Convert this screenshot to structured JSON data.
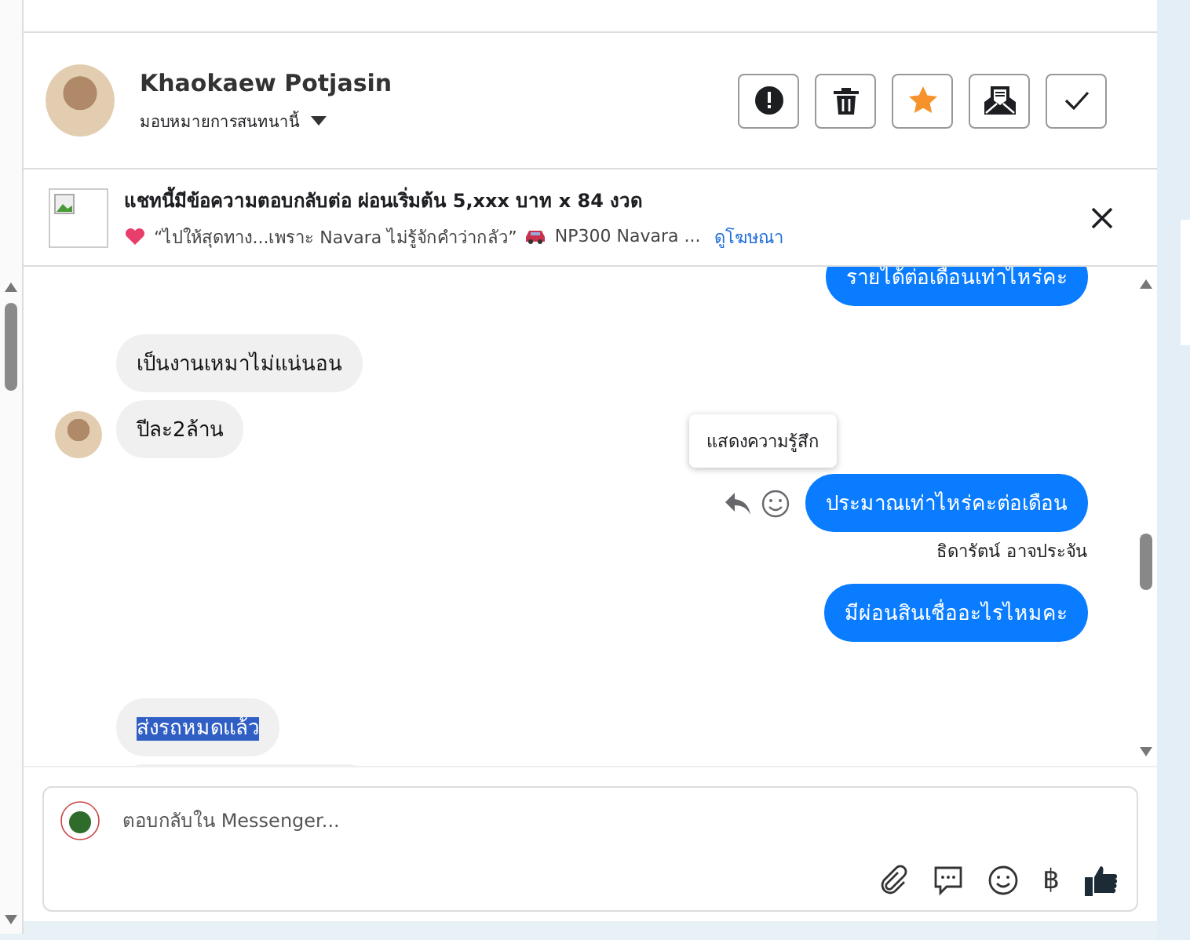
{
  "contact": {
    "name": "Khaokaew Potjasin",
    "assign_label": "มอบหมายการสนทนานี้"
  },
  "header_buttons": [
    {
      "kind": "alert"
    },
    {
      "kind": "trash"
    },
    {
      "kind": "star"
    },
    {
      "kind": "mail"
    },
    {
      "kind": "check"
    }
  ],
  "ad": {
    "title": "แชทนี้มีข้อความตอบกลับต่อ ผ่อนเริ่มต้น 5,xxx บาท x 84 งวด",
    "subtitle": "“ไปให้สุดทาง...เพราะ Navara ไม่รู้จักคำว่ากลัว”",
    "subtitle_2": "NP300 Navara ...",
    "link": "ดูโฆษณา"
  },
  "messages": [
    {
      "kind": "outgoing",
      "text": "รายได้ต่อเดือนเท่าไหร่คะ",
      "highlighted": false
    },
    {
      "kind": "incoming",
      "text": "เป็นงานเหมาไม่แน่นอน",
      "avatar": false,
      "highlighted": false
    },
    {
      "kind": "incoming",
      "text": "ปีละ2ล้าน",
      "avatar": true,
      "highlighted": false
    },
    {
      "kind": "outgoing",
      "text": "ประมาณเท่าไหร่คะต่อเดือน",
      "highlighted": false,
      "tooltip": "แสดงความรู้สึก",
      "sender": "ธิดารัตน์ อาจประจัน"
    },
    {
      "kind": "outgoing",
      "text": "มีผ่อนสินเชื่ออะไรไหมคะ",
      "highlighted": false
    },
    {
      "kind": "incoming",
      "text": "ส่งรถหมดแล้ว",
      "avatar": false,
      "highlighted": true
    }
  ],
  "composer": {
    "placeholder": "ตอบกลับใน Messenger...",
    "currency": "฿"
  }
}
